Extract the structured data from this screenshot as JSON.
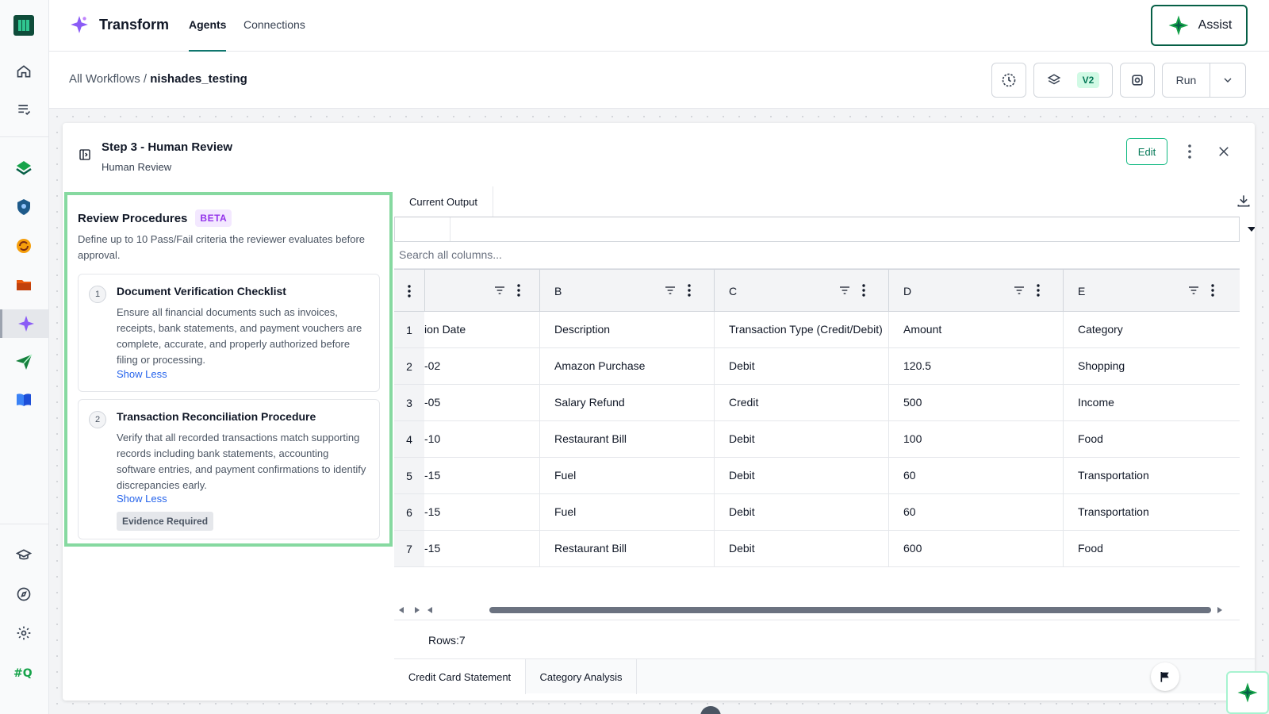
{
  "app": {
    "brand": "Transform",
    "nav_tabs": [
      "Agents",
      "Connections"
    ],
    "assist_label": "Assist"
  },
  "breadcrumb": {
    "parent": "All Workflows /",
    "current": "nishades_testing"
  },
  "toolbar": {
    "version": "V2",
    "run_label": "Run"
  },
  "step": {
    "title": "Step 3 - Human Review",
    "subtitle": "Human Review",
    "edit_label": "Edit"
  },
  "review": {
    "title": "Review Procedures",
    "badge": "BETA",
    "description": "Define up to 10 Pass/Fail criteria the reviewer evaluates before approval.",
    "procedures": [
      {
        "number": "1",
        "title": "Document Verification Checklist",
        "description": "Ensure all financial documents such as invoices, receipts, bank statements, and payment vouchers are complete, accurate, and properly authorized before filing or processing.",
        "toggle": "Show Less"
      },
      {
        "number": "2",
        "title": "Transaction Reconciliation Procedure",
        "description": "Verify that all recorded transactions match supporting records including bank statements, accounting software entries, and payment confirmations to identify discrepancies early.",
        "toggle": "Show Less",
        "tag": "Evidence Required"
      }
    ]
  },
  "output": {
    "tab_label": "Current Output",
    "search_placeholder": "Search all columns...",
    "columns": [
      "B",
      "C",
      "D",
      "E"
    ],
    "rows": [
      {
        "n": "1",
        "a": "ion Date",
        "b": "Description",
        "c": "Transaction Type (Credit/Debit)",
        "d": "Amount",
        "e": "Category"
      },
      {
        "n": "2",
        "a": "-02",
        "b": "Amazon Purchase",
        "c": "Debit",
        "d": "120.5",
        "e": "Shopping"
      },
      {
        "n": "3",
        "a": "-05",
        "b": "Salary Refund",
        "c": "Credit",
        "d": "500",
        "e": "Income"
      },
      {
        "n": "4",
        "a": "-10",
        "b": "Restaurant Bill",
        "c": "Debit",
        "d": "100",
        "e": "Food"
      },
      {
        "n": "5",
        "a": "-15",
        "b": "Fuel",
        "c": "Debit",
        "d": "60",
        "e": "Transportation"
      },
      {
        "n": "6",
        "a": "-15",
        "b": "Fuel",
        "c": "Debit",
        "d": "60",
        "e": "Transportation"
      },
      {
        "n": "7",
        "a": "-15",
        "b": "Restaurant Bill",
        "c": "Debit",
        "d": "600",
        "e": "Food"
      }
    ],
    "rows_label": "Rows:7",
    "sheets": [
      "Credit Card Statement",
      "Category Analysis"
    ]
  },
  "colors": {
    "accent": "#0f766e",
    "review_border": "#86d9a0",
    "beta": "#9333ea"
  }
}
